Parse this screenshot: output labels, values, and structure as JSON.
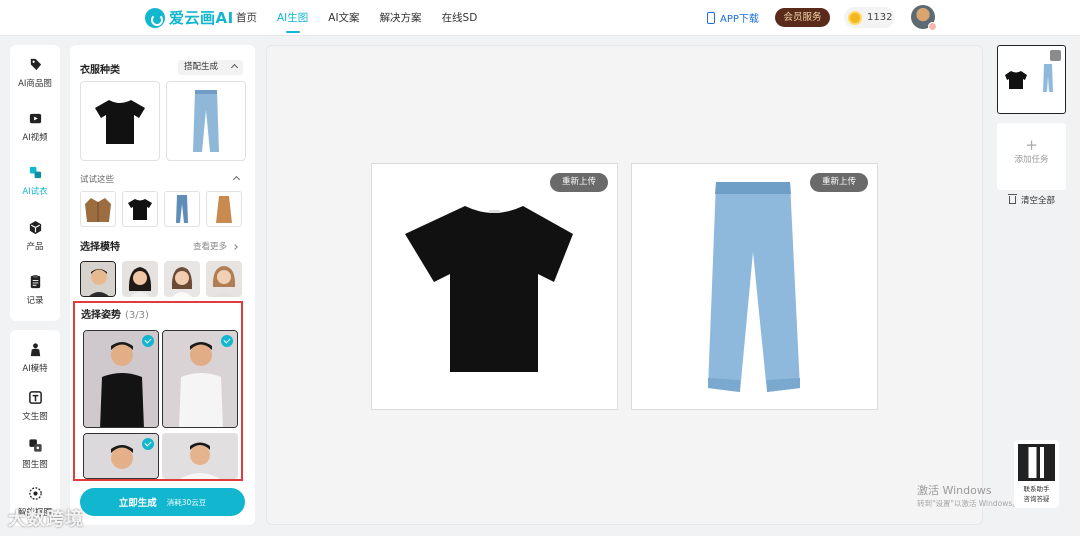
{
  "brand": {
    "name": "爱云画AI",
    "accent": "#12b7cf"
  },
  "nav": [
    {
      "label": "首页"
    },
    {
      "label": "AI生图",
      "active": true
    },
    {
      "label": "AI文案"
    },
    {
      "label": "解决方案"
    },
    {
      "label": "在线SD"
    }
  ],
  "header": {
    "app_download": "APP下载",
    "vip": "会员服务",
    "coins": "1132"
  },
  "rail_top": [
    {
      "label": "AI商品图",
      "icon": "tag-icon"
    },
    {
      "label": "AI视频",
      "icon": "video-icon"
    },
    {
      "label": "AI试衣",
      "icon": "tryon-icon",
      "active": true
    },
    {
      "label": "产品",
      "icon": "product-icon"
    },
    {
      "label": "记录",
      "icon": "record-icon"
    }
  ],
  "rail_bottom": [
    {
      "label": "AI模特",
      "icon": "model-icon"
    },
    {
      "label": "文生图",
      "icon": "text-to-image-icon"
    },
    {
      "label": "图生图",
      "icon": "image-to-image-icon"
    },
    {
      "label": "智能抠图",
      "icon": "smart-cutout-icon"
    }
  ],
  "panel": {
    "clothing_type": "衣服种类",
    "combo": "搭配生成",
    "try_these": "试试这些",
    "choose_model": "选择模特",
    "see_more": "查看更多",
    "choose_pose": "选择姿势",
    "pose_count": "(3/3)",
    "generate": "立即生成",
    "cost": "消耗30云豆"
  },
  "canvas": {
    "reupload": "重新上传",
    "reupload2": "重新上传"
  },
  "right": {
    "add_task": "添加任务",
    "clear_all": "清空全部",
    "qr_line1": "联系助手",
    "qr_line2": "咨询答疑"
  },
  "system": {
    "activate_title": "激活 Windows",
    "activate_sub": "转到\"设置\"以激活 Windows。"
  },
  "watermark": "大数跨境"
}
